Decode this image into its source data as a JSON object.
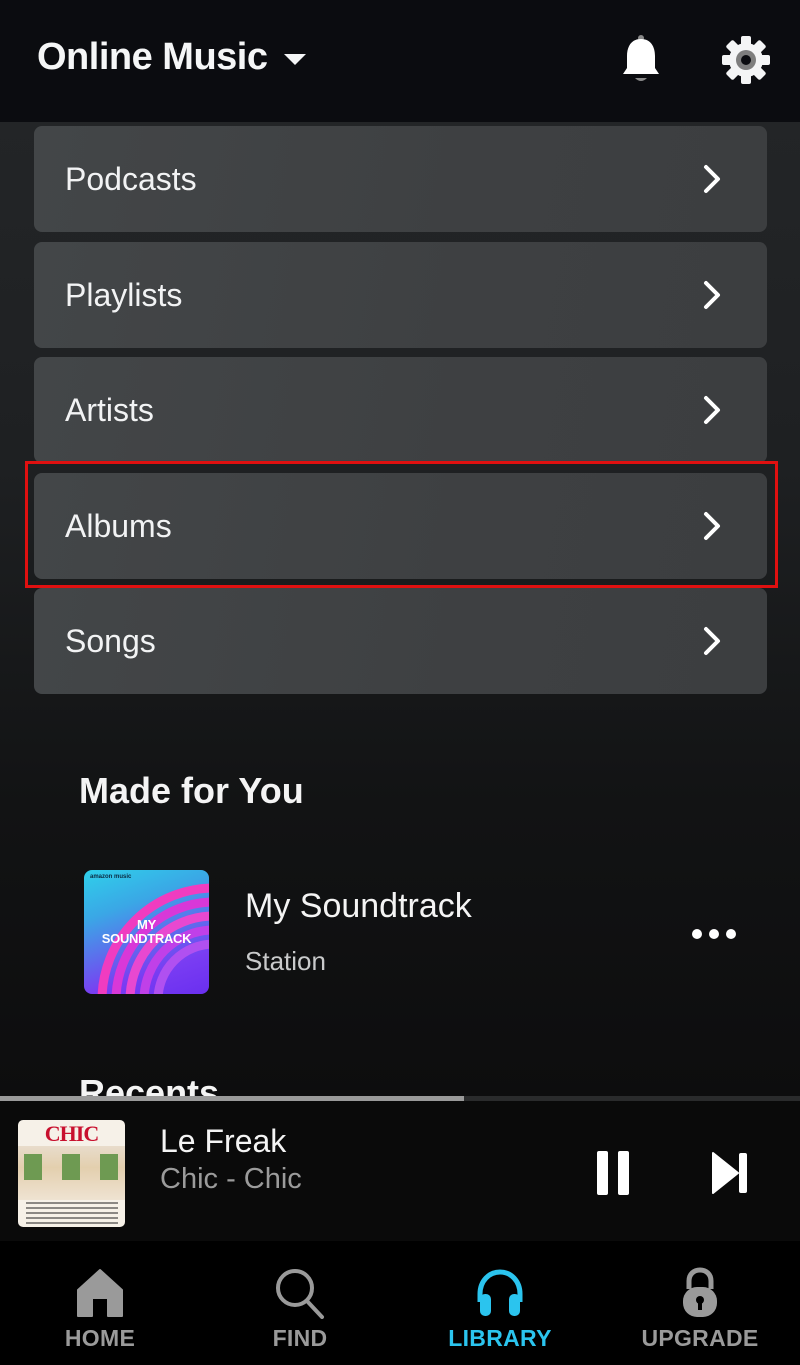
{
  "header": {
    "title": "Online Music",
    "notifications_icon": "bell-icon",
    "settings_icon": "gear-icon"
  },
  "library_menu": {
    "items": [
      {
        "label": "Podcasts",
        "icon": "chevron-right-icon"
      },
      {
        "label": "Playlists",
        "icon": "chevron-right-icon"
      },
      {
        "label": "Artists",
        "icon": "chevron-right-icon"
      },
      {
        "label": "Albums",
        "icon": "chevron-right-icon",
        "highlighted": true
      },
      {
        "label": "Songs",
        "icon": "chevron-right-icon"
      }
    ],
    "highlight_color": "#e01010"
  },
  "made_for_you": {
    "heading": "Made for You",
    "items": [
      {
        "title": "My Soundtrack",
        "subtitle": "Station",
        "cover_brand": "amazon music",
        "cover_title_line1": "MY",
        "cover_title_line2": "SOUNDTRACK"
      }
    ]
  },
  "recents": {
    "heading": "Recents"
  },
  "now_playing": {
    "title": "Le Freak",
    "subtitle": "Chic - Chic",
    "art_logo": "CHIC",
    "progress_percent": 58,
    "pause_icon": "pause-icon",
    "next_icon": "skip-next-icon"
  },
  "bottom_nav": {
    "active_color": "#2bc4ee",
    "inactive_color": "#9a9a9a",
    "items": [
      {
        "label": "HOME",
        "icon": "home-icon",
        "active": false
      },
      {
        "label": "FIND",
        "icon": "search-icon",
        "active": false
      },
      {
        "label": "LIBRARY",
        "icon": "headphones-icon",
        "active": true
      },
      {
        "label": "UPGRADE",
        "icon": "lock-icon",
        "active": false
      }
    ]
  }
}
